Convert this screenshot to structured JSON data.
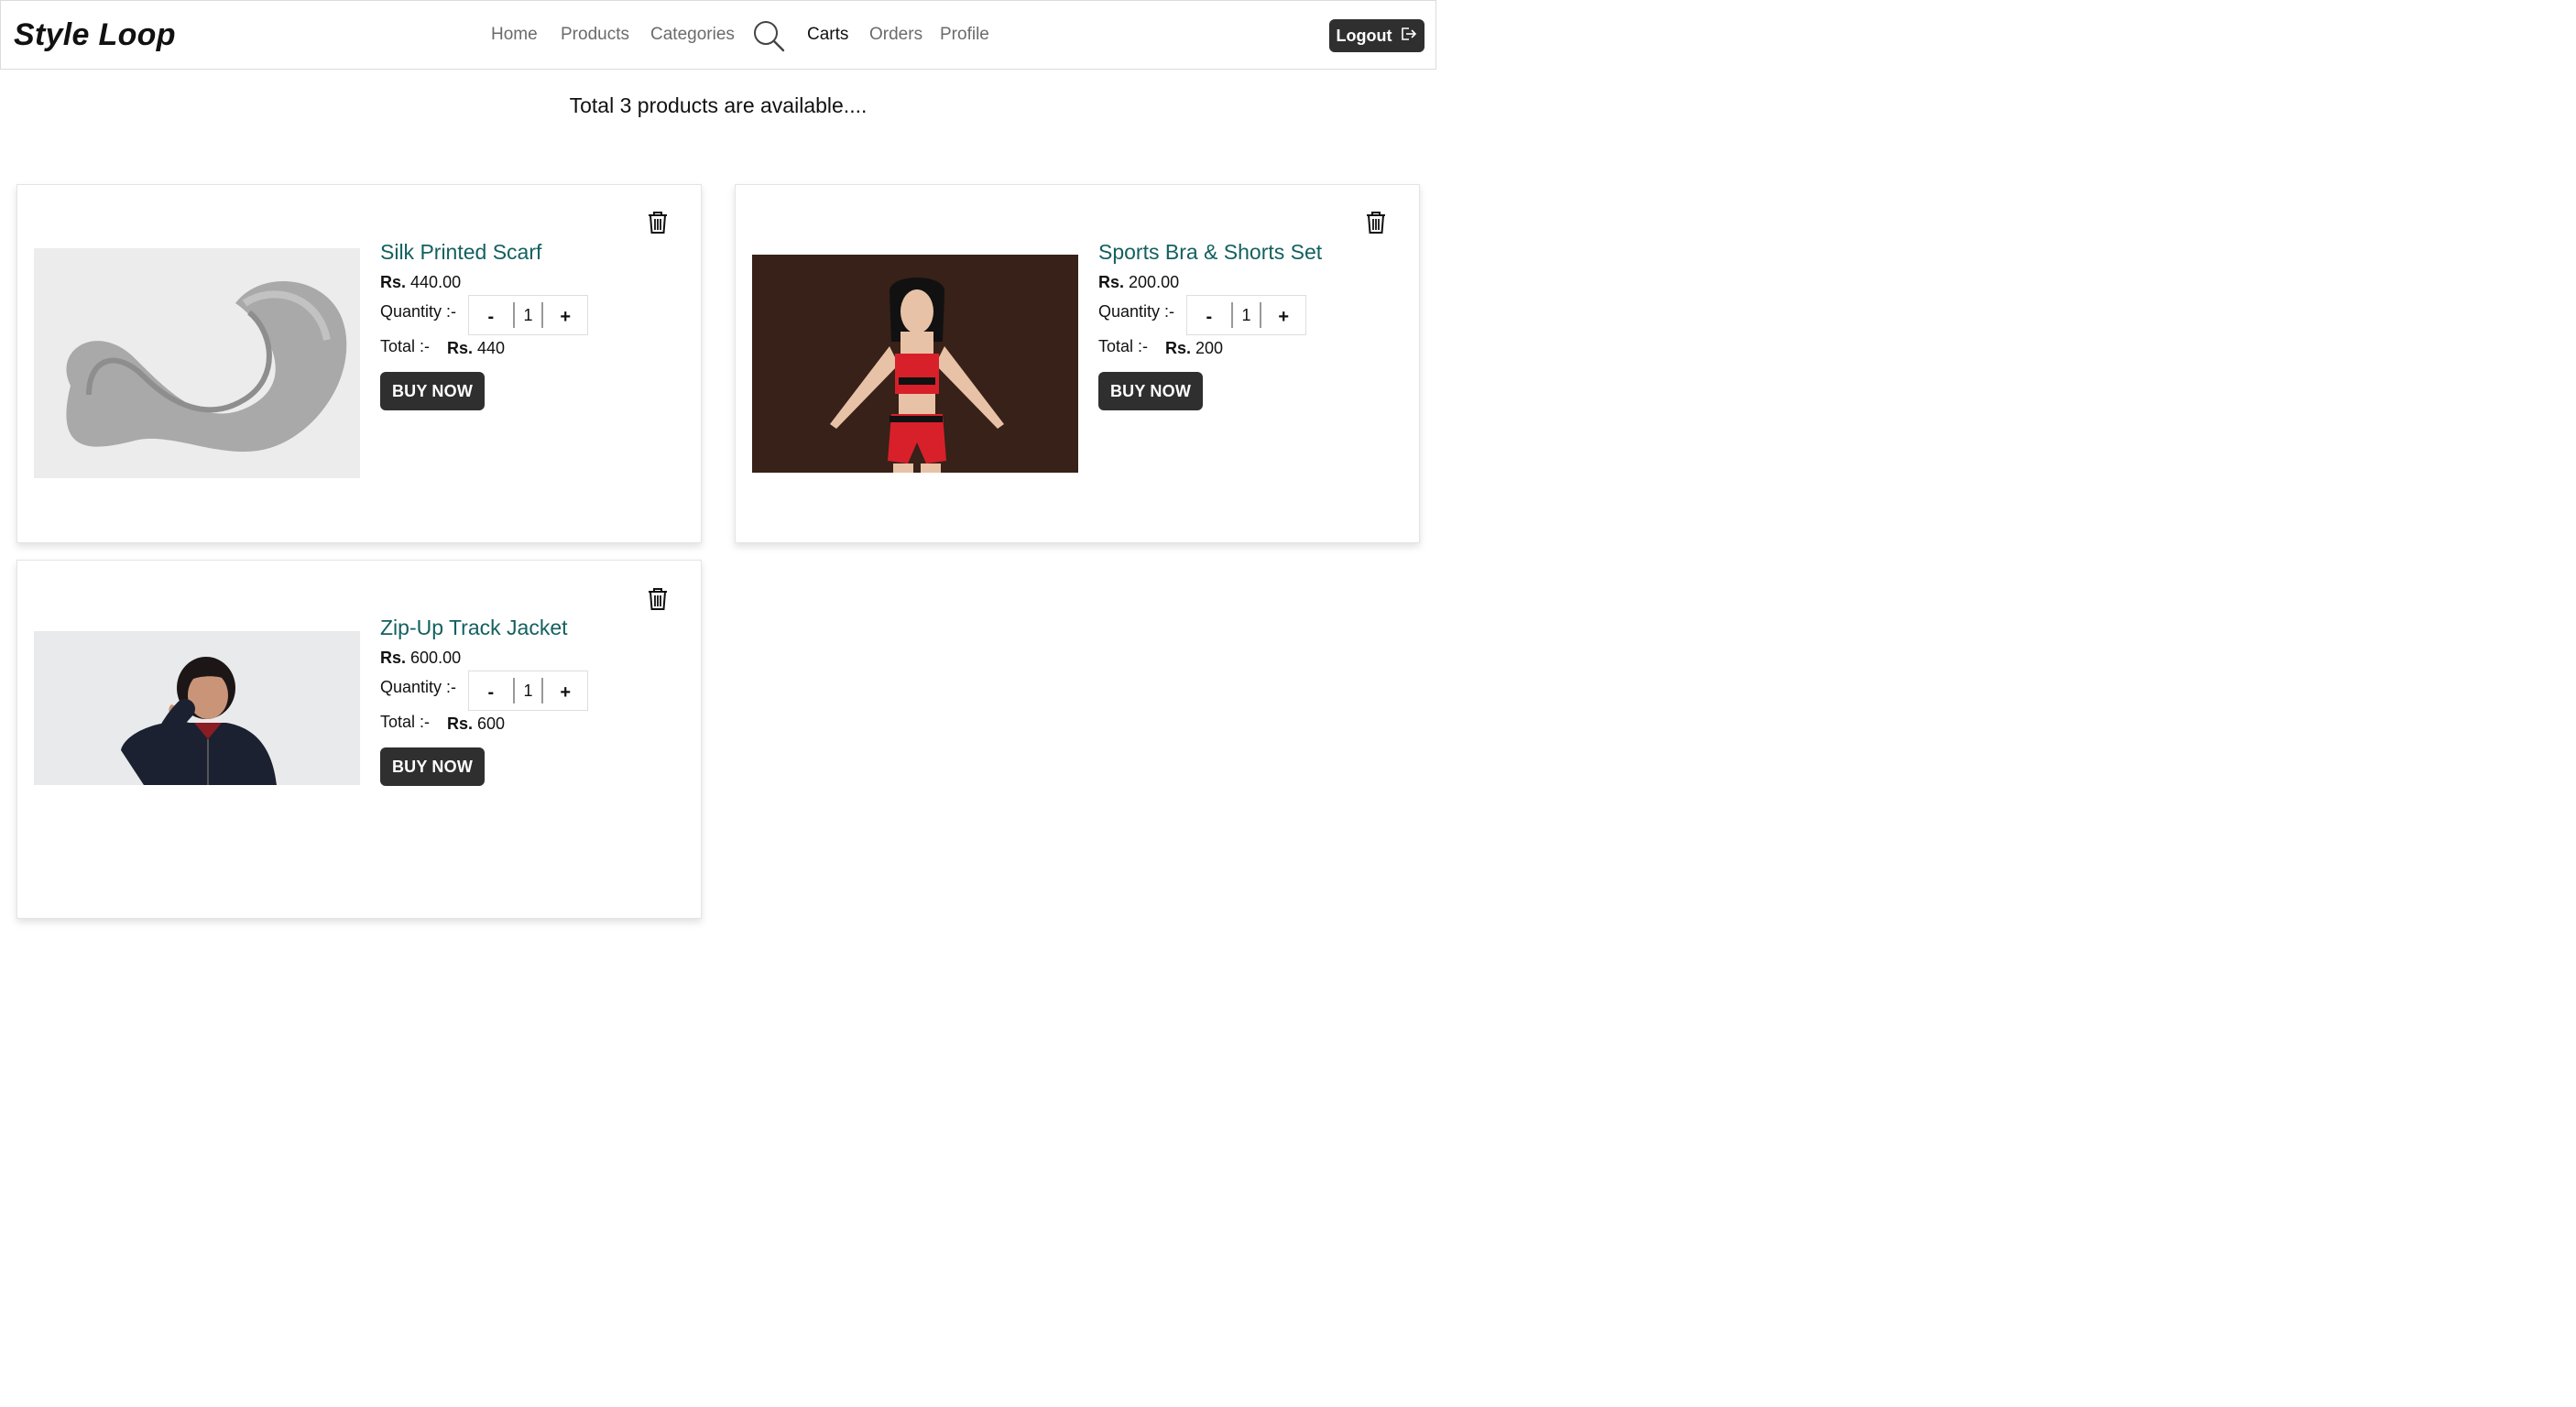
{
  "navbar": {
    "brand": "Style Loop",
    "links": [
      "Home",
      "Products",
      "Categories",
      "Carts",
      "Orders",
      "Profile"
    ],
    "active": "Carts",
    "logout_label": "Logout"
  },
  "heading": "Total 3 products are available....",
  "labels": {
    "currency": "Rs.",
    "quantity": "Quantity :-",
    "total": "Total :-",
    "buy_now": "BUY NOW",
    "minus": "-",
    "plus": "+"
  },
  "cart_items": [
    {
      "name": "Silk Printed Scarf",
      "price": "440.00",
      "quantity": "1",
      "total": "440"
    },
    {
      "name": "Sports Bra & Shorts Set",
      "price": "200.00",
      "quantity": "1",
      "total": "200"
    },
    {
      "name": "Zip-Up Track Jacket",
      "price": "600.00",
      "quantity": "1",
      "total": "600"
    }
  ],
  "colors": {
    "title": "#136060",
    "button": "#2f2f2f"
  }
}
